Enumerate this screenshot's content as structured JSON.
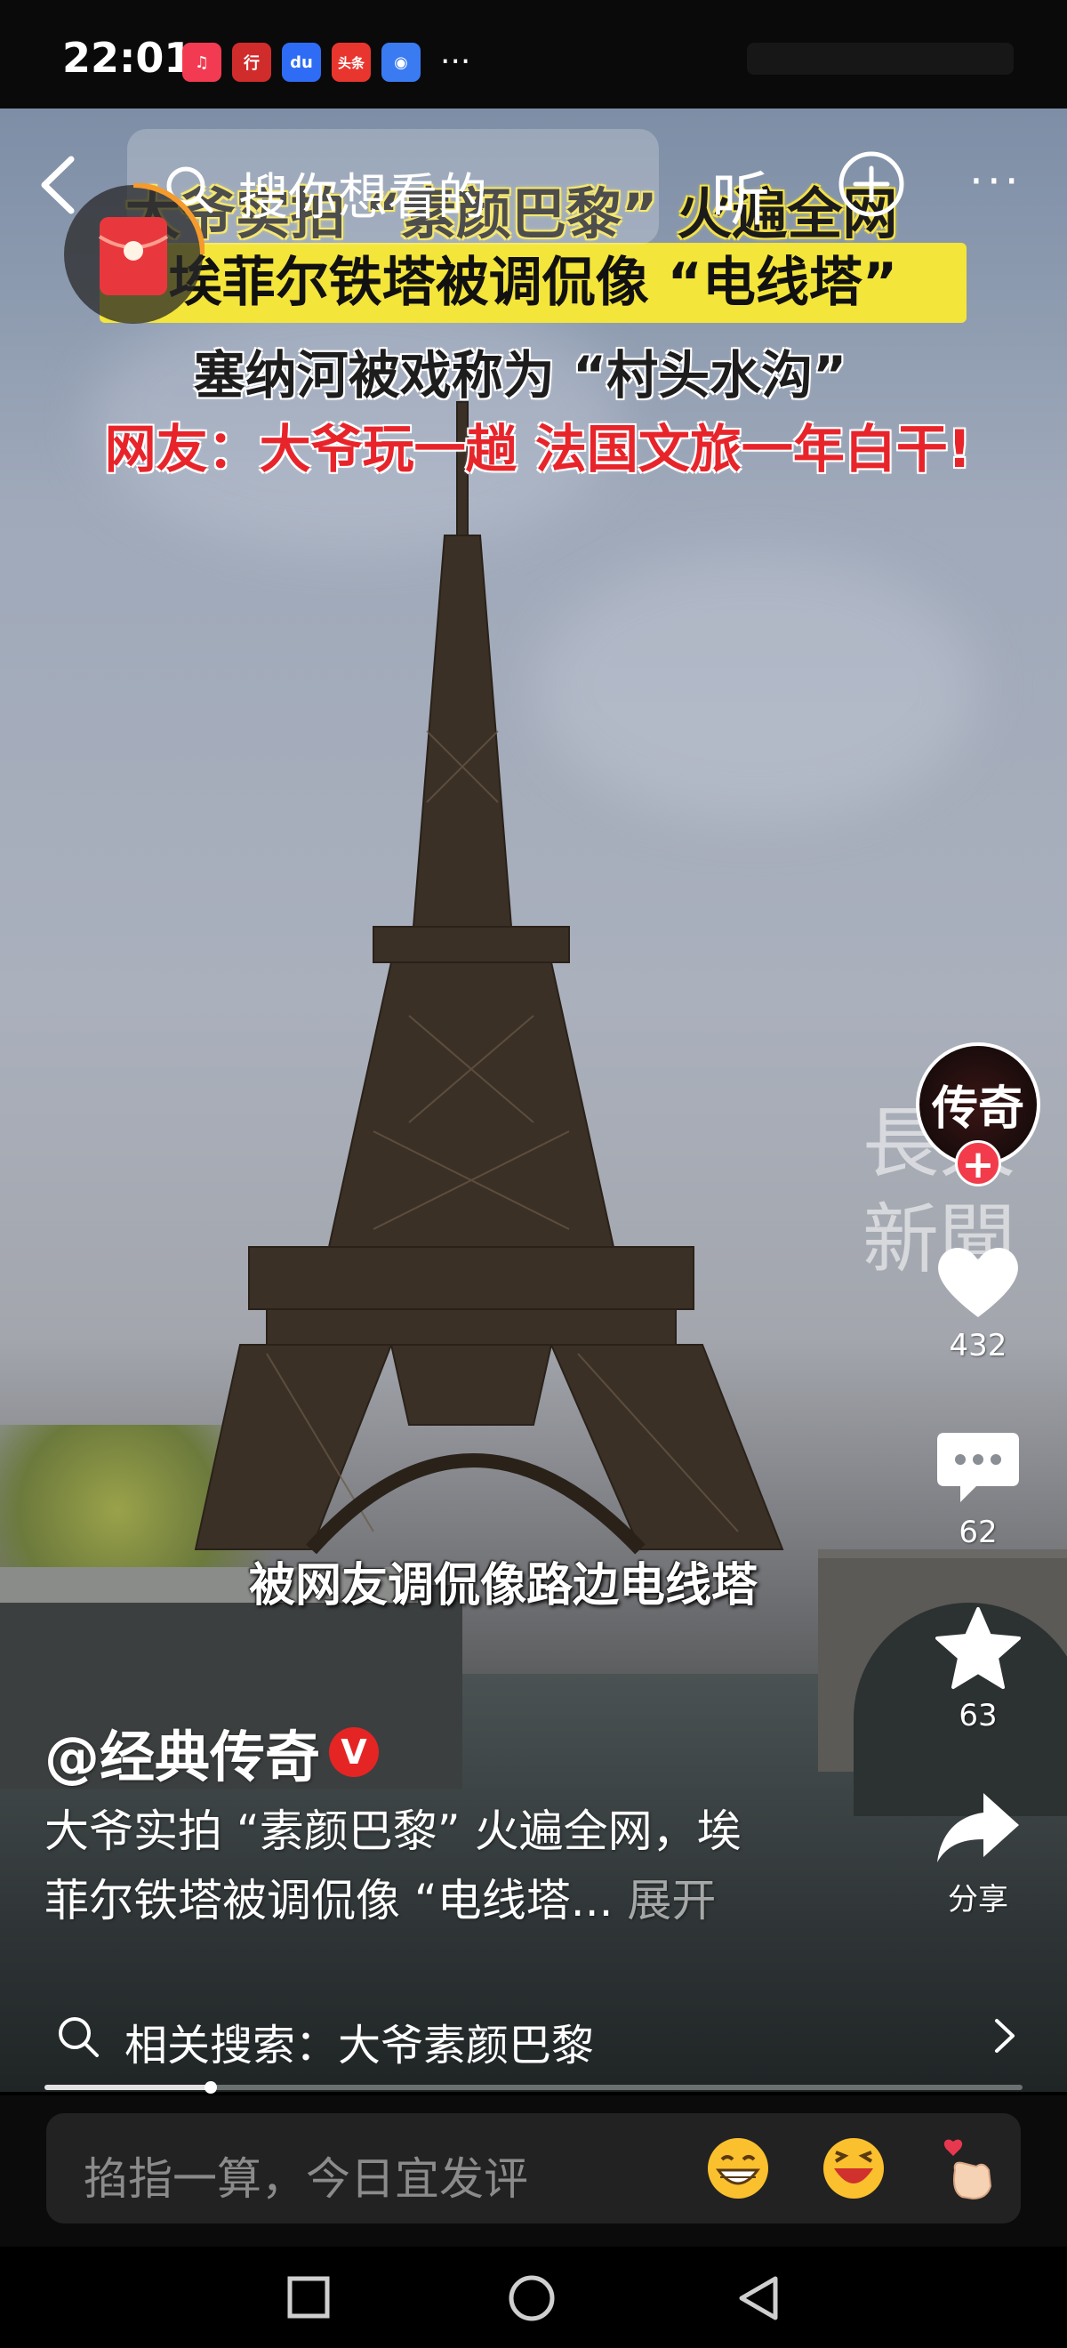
{
  "status": {
    "time": "22:01",
    "apps": [
      {
        "icon": "music-app-icon",
        "color": "#f23b52",
        "label": "♫"
      },
      {
        "icon": "bank-app-icon",
        "color": "#d12c2c",
        "label": "行"
      },
      {
        "icon": "baidu-app-icon",
        "color": "#2f6cf5",
        "label": "du"
      },
      {
        "icon": "toutiao-app-icon",
        "color": "#e8362f",
        "label": "头条"
      },
      {
        "icon": "shield-app-icon",
        "color": "#3a7bf2",
        "label": "◉"
      }
    ],
    "more": "···"
  },
  "topbar": {
    "search_placeholder": "搜你想看的",
    "listen_label": "听"
  },
  "video": {
    "headline_1": "大爷实拍 “素颜巴黎” 火遍全网",
    "headline_2": "埃菲尔铁塔被调侃像 “电线塔”",
    "headline_3": "塞纳河被戏称为 “村头水沟”",
    "headline_4": "网友：大爷玩一趟 法国文旅一年白干!",
    "subtitle": "被网友调侃像路边电线塔",
    "watermark": "長天新聞"
  },
  "sidebar": {
    "avatar_text": "传奇",
    "likes": "432",
    "comments": "62",
    "favorites": "63",
    "share_label": "分享"
  },
  "post": {
    "author": "@经典传奇",
    "verified": "V",
    "desc_line1": "大爷实拍 “素颜巴黎” 火遍全网，埃",
    "desc_line2": "菲尔铁塔被调侃像 “电线塔...",
    "expand": " 展开",
    "progress": 0.17
  },
  "related": {
    "text": "相关搜索：大爷素颜巴黎"
  },
  "comment": {
    "placeholder": "掐指一算，今日宜发评"
  },
  "colors": {
    "accent_red": "#f23c4b",
    "headline_yellow": "#f4e53a"
  }
}
